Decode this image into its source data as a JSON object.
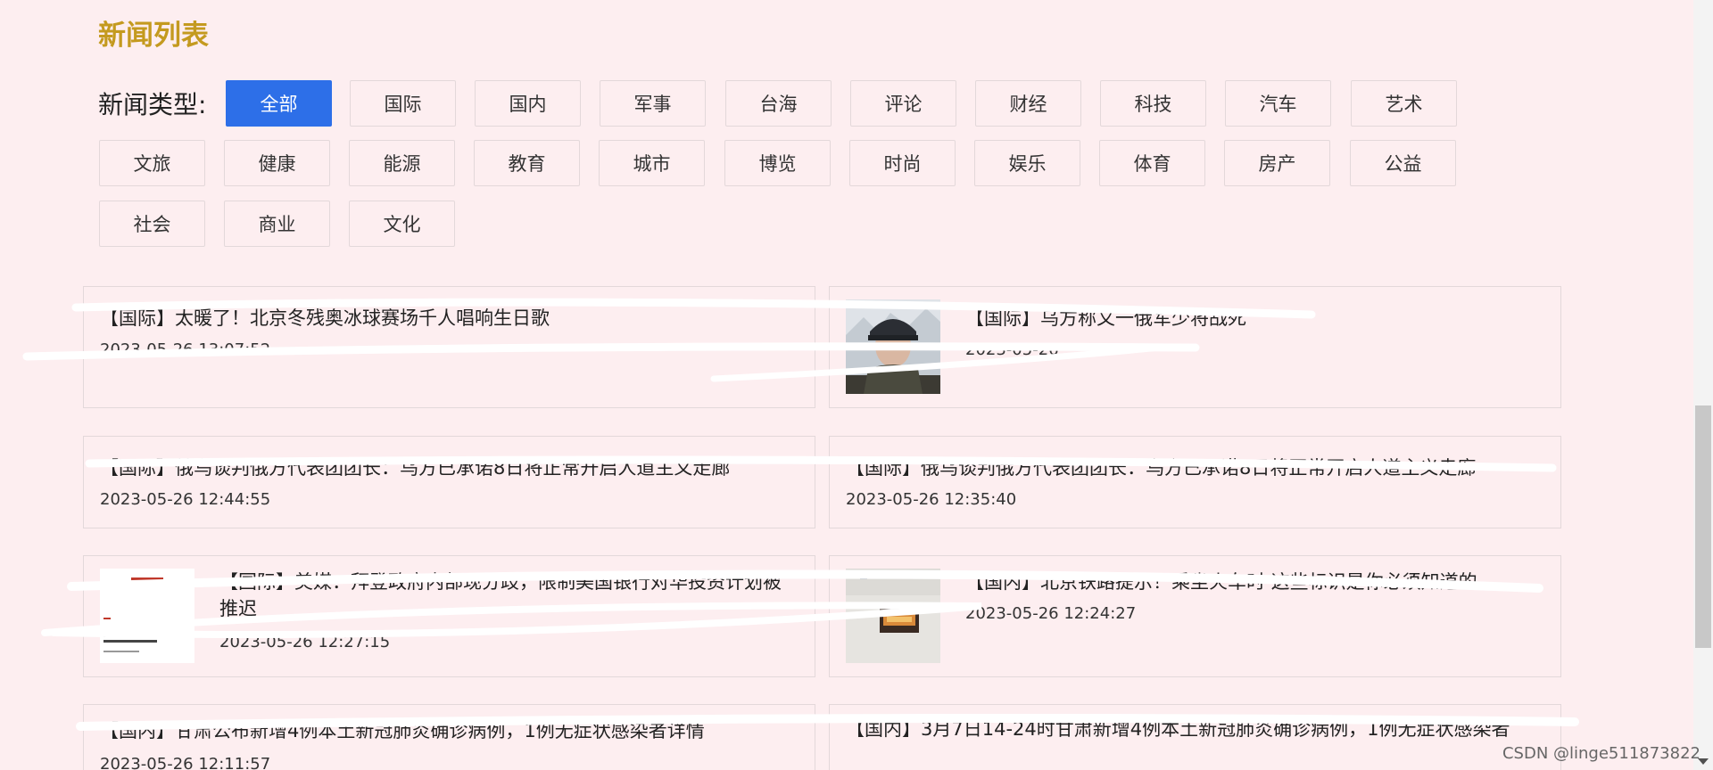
{
  "page": {
    "title": "新闻列表"
  },
  "filter": {
    "label": "新闻类型:",
    "active": "全部",
    "categories": [
      "全部",
      "国际",
      "国内",
      "军事",
      "台海",
      "评论",
      "财经",
      "科技",
      "汽车",
      "艺术",
      "文旅",
      "健康",
      "能源",
      "教育",
      "城市",
      "博览",
      "时尚",
      "娱乐",
      "体育",
      "房产",
      "公益",
      "社会",
      "商业",
      "文化"
    ]
  },
  "news": [
    {
      "title": "【国际】太暖了！北京冬残奥冰球赛场千人唱响生日歌",
      "time": "2023-05-26 13:07:52",
      "has_image": false
    },
    {
      "title": "【国际】乌方称又一俄军少将战死",
      "time": "2023-05-26 ··:·:32",
      "has_image": true,
      "image": "soldier-photo"
    },
    {
      "title": "【国际】俄乌谈判俄方代表团团长：乌方已承诺8日将正常开启人道主义走廊",
      "time": "2023-05-26 12:44:55",
      "has_image": false
    },
    {
      "title": "【国际】俄乌谈判俄方代表团团长：乌方已承诺8日将正常开启人道主义走廊",
      "time": "2023-05-26 12:35:40",
      "has_image": false
    },
    {
      "title": "【国际】美媒：拜登政府内部现分歧，限制美国银行对华投资计划被推迟",
      "time": "2023-05-26 12:27:15",
      "has_image": true,
      "image": "news-article-screenshot",
      "thumb_text": "White House split delays plans for investment"
    },
    {
      "title": "【国内】北京铁路提示！乘坐火车时 这些标识是你必须知道的",
      "time": "2023-05-26 12:24:27",
      "has_image": true,
      "image": "train-sign-photo"
    },
    {
      "title": "【国内】甘肃公布新增4例本土新冠肺炎确诊病例，1例无症状感染者详情",
      "time": "2023-05-26 12:11:57",
      "has_image": false
    },
    {
      "title": "【国内】3月7日14-24时甘肃新增4例本土新冠肺炎确诊病例，1例无症状感染者",
      "time": "",
      "has_image": false
    }
  ],
  "watermark": "CSDN @linge511873822",
  "colors": {
    "background": "#fdeef0",
    "title": "#c49a1f",
    "active_button": "#2d6fe8"
  }
}
